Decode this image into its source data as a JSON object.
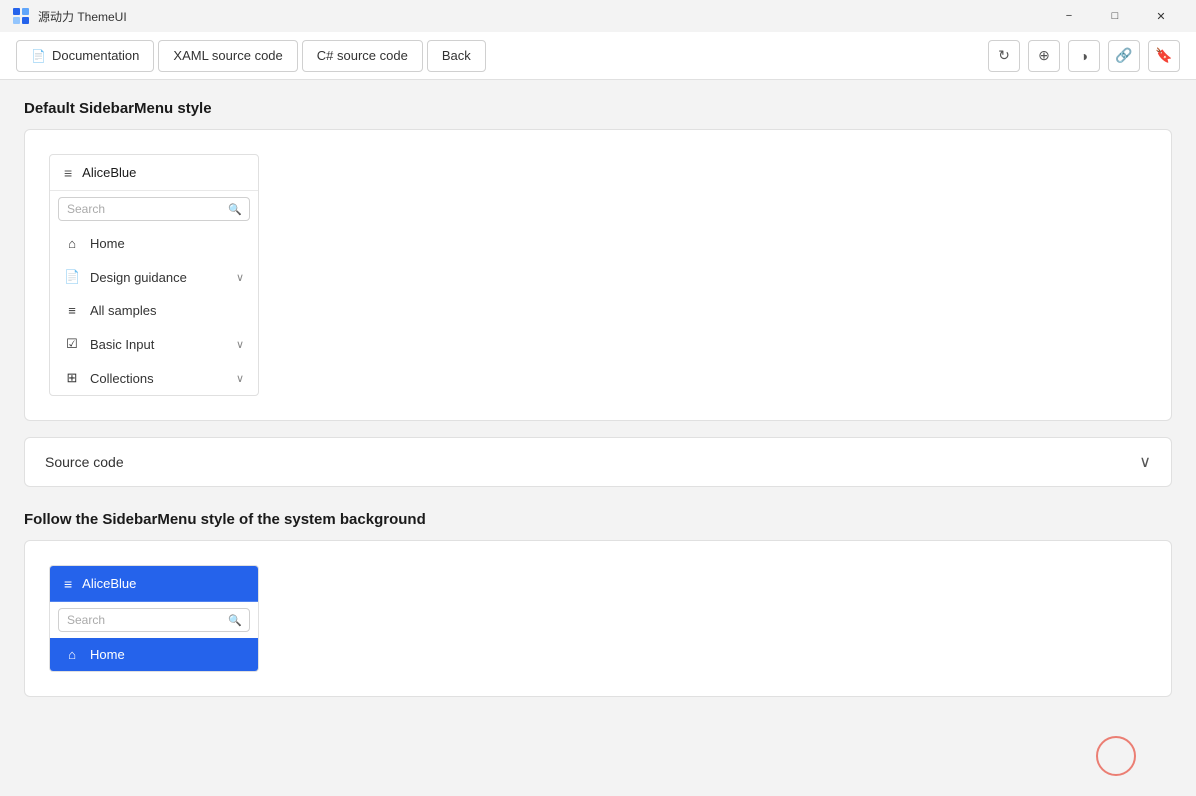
{
  "titlebar": {
    "logo_text": "源动力 ThemeUI",
    "min_label": "−",
    "max_label": "□",
    "close_label": "✕"
  },
  "toolbar": {
    "doc_btn": "Documentation",
    "xaml_btn": "XAML source code",
    "csharp_btn": "C# source code",
    "back_btn": "Back",
    "icons": {
      "refresh": "↻",
      "share": "⊕",
      "contrast": "◑",
      "link": "🔗",
      "bookmark": "🔖"
    }
  },
  "section1": {
    "title": "Default SidebarMenu style",
    "sidebar": {
      "title": "AliceBlue",
      "search_placeholder": "Search",
      "nav_items": [
        {
          "icon": "⌂",
          "label": "Home",
          "has_chevron": false
        },
        {
          "icon": "📄",
          "label": "Design guidance",
          "has_chevron": true
        },
        {
          "icon": "≡",
          "label": "All samples",
          "has_chevron": false
        },
        {
          "icon": "☑",
          "label": "Basic Input",
          "has_chevron": true
        },
        {
          "icon": "⊞",
          "label": "Collections",
          "has_chevron": true
        }
      ]
    },
    "source_code_label": "Source code",
    "chevron_down": "∨"
  },
  "section2": {
    "title": "Follow the SidebarMenu style of the system background",
    "sidebar": {
      "title": "AliceBlue",
      "search_placeholder": "Search",
      "nav_items": [
        {
          "icon": "⌂",
          "label": "Home",
          "has_chevron": false,
          "active": true
        }
      ]
    }
  }
}
